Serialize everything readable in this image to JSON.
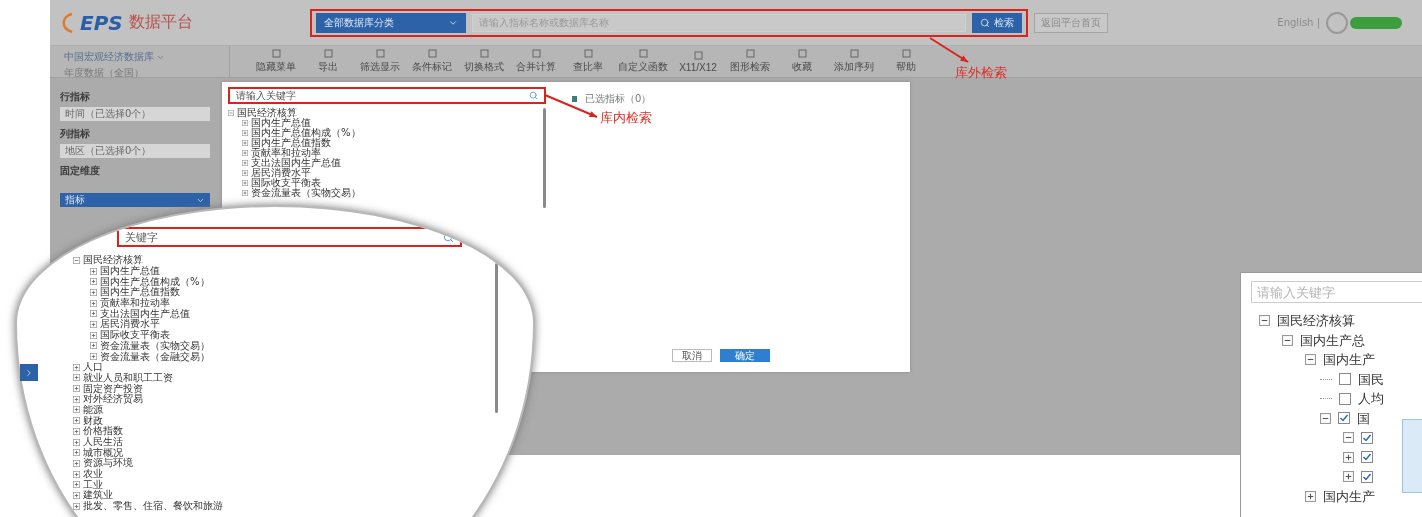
{
  "header": {
    "logo_mark": "EPS",
    "logo_text": "数据平台",
    "category": "全部数据库分类",
    "search_placeholder": "请输入指标名称或数据库名称",
    "search_button": "检索",
    "platform_button": "返回平台首页",
    "language": "English |"
  },
  "database": {
    "name": "中国宏观经济数据库",
    "subtitle": "年度数据（全国）"
  },
  "toolbar": [
    "隐藏菜单",
    "导出",
    "筛选显示",
    "条件标记",
    "切换格式",
    "合并计算",
    "查比率",
    "自定义函数",
    "X11/X12",
    "图形检索",
    "收藏",
    "添加序列",
    "帮助"
  ],
  "sidebar": {
    "fields": [
      {
        "label": "行指标",
        "value": "时间（已选择0个）"
      },
      {
        "label": "列指标",
        "value": "地区（已选择0个）"
      }
    ],
    "fixed_label": "固定维度",
    "dimension": "指标"
  },
  "dialog": {
    "search_placeholder": "请输入关键字",
    "tree": [
      {
        "label": "国民经济核算",
        "expanded": true,
        "children": [
          {
            "label": "国内生产总值",
            "expanded": false
          },
          {
            "label": "国内生产总值构成（%）",
            "expanded": false
          },
          {
            "label": "国内生产总值指数",
            "expanded": false
          },
          {
            "label": "贡献率和拉动率",
            "expanded": false
          },
          {
            "label": "支出法国内生产总值",
            "expanded": false
          },
          {
            "label": "居民消费水平",
            "expanded": false
          },
          {
            "label": "国际收支平衡表",
            "expanded": false
          },
          {
            "label": "资金流量表（实物交易）",
            "expanded": false
          }
        ]
      }
    ],
    "selected_title": "已选指标（0）",
    "buttons": [
      {
        "label": "取消",
        "kind": "secondary"
      },
      {
        "label": "确定",
        "kind": "primary"
      }
    ]
  },
  "annotations": [
    {
      "text": "库外检索"
    },
    {
      "text": "库内检索"
    }
  ],
  "magnifier": {
    "search_placeholder": "关键字",
    "tree": [
      {
        "label": "国民经济核算",
        "expanded": true,
        "children": [
          {
            "label": "国内生产总值",
            "expanded": false
          },
          {
            "label": "国内生产总值构成（%）",
            "expanded": false
          },
          {
            "label": "国内生产总值指数",
            "expanded": false
          },
          {
            "label": "贡献率和拉动率",
            "expanded": false
          },
          {
            "label": "支出法国内生产总值",
            "expanded": false
          },
          {
            "label": "居民消费水平",
            "expanded": false
          },
          {
            "label": "国际收支平衡表",
            "expanded": false
          },
          {
            "label": "资金流量表（实物交易）",
            "expanded": false
          },
          {
            "label": "资金流量表（金融交易）",
            "expanded": false
          }
        ]
      },
      {
        "label": "人口",
        "expanded": false
      },
      {
        "label": "就业人员和职工工资",
        "expanded": false
      },
      {
        "label": "固定资产投资",
        "expanded": false
      },
      {
        "label": "对外经济贸易",
        "expanded": false
      },
      {
        "label": "能源",
        "expanded": false
      },
      {
        "label": "财政",
        "expanded": false
      },
      {
        "label": "价格指数",
        "expanded": false
      },
      {
        "label": "人民生活",
        "expanded": false
      },
      {
        "label": "城市概况",
        "expanded": false
      },
      {
        "label": "资源与环境",
        "expanded": false
      },
      {
        "label": "农业",
        "expanded": false
      },
      {
        "label": "工业",
        "expanded": false
      },
      {
        "label": "建筑业",
        "expanded": false
      },
      {
        "label": "批发、零售、住宿、餐饮和旅游",
        "expanded": false
      }
    ]
  },
  "inset": {
    "search_placeholder": "请输入关键字",
    "tree": [
      {
        "kind": "group",
        "label": "国民经济核算",
        "expanded": true,
        "children": [
          {
            "kind": "group",
            "label": "国内生产总",
            "expanded": true,
            "children": [
              {
                "kind": "group",
                "label": "国内生产",
                "expanded": true,
                "children": [
                  {
                    "kind": "option",
                    "label": "国民",
                    "checked": false
                  },
                  {
                    "kind": "option",
                    "label": "人均",
                    "checked": false
                  },
                  {
                    "kind": "option-group",
                    "label": "国",
                    "checked": true,
                    "expanded": true,
                    "children": [
                      {
                        "kind": "option-group",
                        "checked": true,
                        "expanded": true
                      },
                      {
                        "kind": "option-group",
                        "checked": true,
                        "expanded": false
                      },
                      {
                        "kind": "option-group",
                        "checked": true,
                        "expanded": false
                      }
                    ]
                  }
                ]
              },
              {
                "kind": "group",
                "label": "国内生产",
                "expanded": false
              }
            ]
          }
        ]
      }
    ]
  }
}
